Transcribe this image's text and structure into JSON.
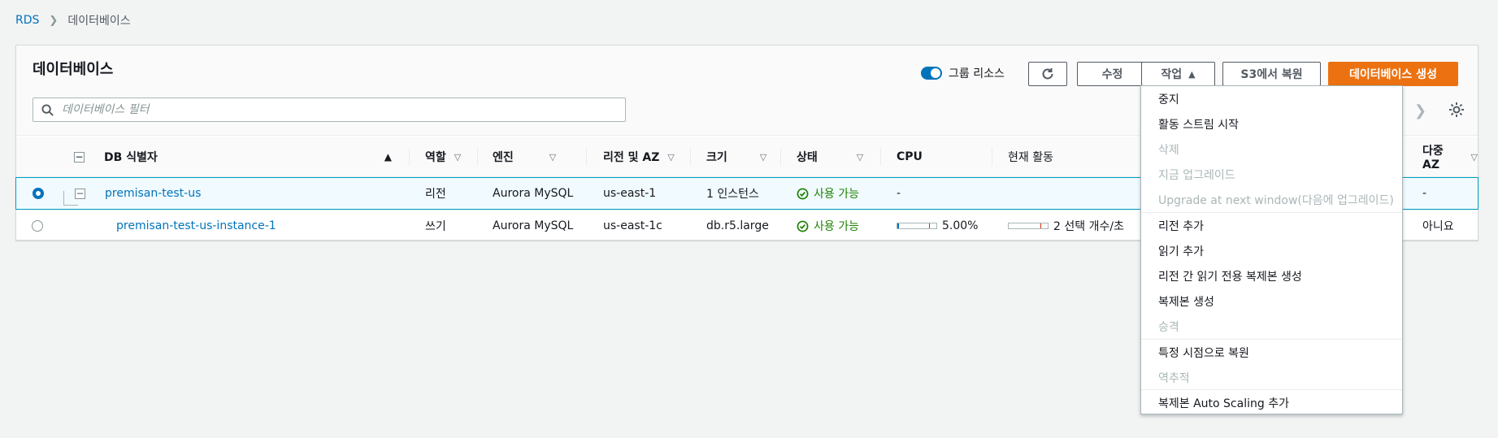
{
  "breadcrumb": {
    "root": "RDS",
    "current": "데이터베이스"
  },
  "panel": {
    "title": "데이터베이스",
    "group_toggle_label": "그룹 리소스",
    "group_toggle_on": true
  },
  "toolbar": {
    "edit_label": "수정",
    "action_label": "작업",
    "s3_restore_label": "S3에서 복원",
    "create_label": "데이터베이스 생성"
  },
  "filter": {
    "placeholder": "데이터베이스 필터"
  },
  "table": {
    "headers": {
      "id": "DB 식별자",
      "role": "역할",
      "engine": "엔진",
      "region": "리전 및 AZ",
      "size": "크기",
      "status": "상태",
      "cpu": "CPU",
      "activity": "현재 활동",
      "multi_az": "다중 AZ"
    },
    "rows": [
      {
        "id": "premisan-test-us",
        "role": "리전",
        "engine": "Aurora MySQL",
        "region": "us-east-1",
        "size": "1 인스턴스",
        "status": "사용 가능",
        "cpu": "-",
        "activity": "",
        "multi_az": "-"
      },
      {
        "id": "premisan-test-us-instance-1",
        "role": "쓰기",
        "engine": "Aurora MySQL",
        "region": "us-east-1c",
        "size": "db.r5.large",
        "status": "사용 가능",
        "cpu": "5.00%",
        "cpu_fraction": 0.05,
        "activity": "2 선택 개수/초",
        "multi_az": "아니요"
      }
    ]
  },
  "action_menu": {
    "items": [
      {
        "label": "중지",
        "disabled": false
      },
      {
        "label": "활동 스트림 시작",
        "disabled": false
      },
      {
        "label": "삭제",
        "disabled": true
      },
      {
        "label": "지금 업그레이드",
        "disabled": true
      },
      {
        "label": "Upgrade at next window(다음에 업그레이드)",
        "disabled": true
      },
      {
        "label": "리전 추가",
        "disabled": false
      },
      {
        "label": "읽기 추가",
        "disabled": false
      },
      {
        "label": "리전 간 읽기 전용 복제본 생성",
        "disabled": false
      },
      {
        "label": "복제본 생성",
        "disabled": false
      },
      {
        "label": "승격",
        "disabled": true
      },
      {
        "label": "특정 시점으로 복원",
        "disabled": false
      },
      {
        "label": "역추적",
        "disabled": true
      },
      {
        "label": "복제본 Auto Scaling 추가",
        "disabled": false
      }
    ]
  },
  "colors": {
    "accent": "#0073bb",
    "primary_button": "#ec7211",
    "success": "#1d8102"
  }
}
